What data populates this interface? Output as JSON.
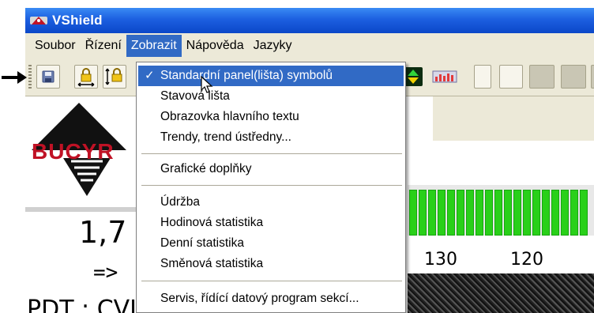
{
  "window": {
    "title": "VShield"
  },
  "menubar": {
    "items": [
      "Soubor",
      "Řízení",
      "Zobrazit",
      "Nápověda",
      "Jazyky"
    ],
    "open_index": 2
  },
  "dropdown": {
    "groups": [
      [
        {
          "label": "Standardní panel(lišta) symbolů",
          "checked": true,
          "highlighted": true
        },
        {
          "label": "Stavová lišta"
        },
        {
          "label": "Obrazovka hlavního textu"
        },
        {
          "label": "Trendy, trend ústředny..."
        }
      ],
      [
        {
          "label": "Grafické doplňky"
        }
      ],
      [
        {
          "label": "Údržba"
        },
        {
          "label": "Hodinová statistika"
        },
        {
          "label": "Denní statistika"
        },
        {
          "label": "Směnová statistika"
        }
      ],
      [
        {
          "label": "Servis, řídící datový program sekcí..."
        }
      ]
    ],
    "check_glyph": "✓"
  },
  "content": {
    "logo_text": "BUCYR",
    "big_value": "1,7",
    "arrow_text": "=>",
    "bottom_text": "PDT : CVIK",
    "scale_labels": [
      "130",
      "120"
    ]
  },
  "colors": {
    "menu_highlight": "#316ac5",
    "titlebar": "#1c5fe0",
    "bar_green": "#29d019",
    "logo_red": "#c01225"
  },
  "icons": [
    "app-icon",
    "save-icon",
    "lock-horizontal-icon",
    "lock-vertical-icon",
    "green-arrows-icon",
    "chart-icon",
    "pointer-arrow-icon",
    "mouse-cursor-icon"
  ]
}
